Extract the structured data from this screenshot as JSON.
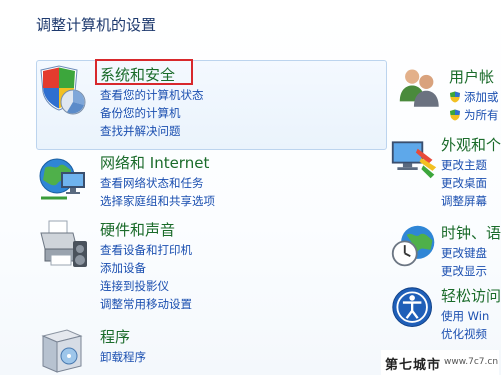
{
  "page_title": "调整计算机的设置",
  "left_categories": [
    {
      "title": "系统和安全",
      "icon": "shield-chart-icon",
      "links": [
        "查看您的计算机状态",
        "备份您的计算机",
        "查找并解决问题"
      ]
    },
    {
      "title": "网络和 Internet",
      "icon": "network-globe-icon",
      "links": [
        "查看网络状态和任务",
        "选择家庭组和共享选项"
      ]
    },
    {
      "title": "硬件和声音",
      "icon": "printer-icon",
      "links": [
        "查看设备和打印机",
        "添加设备",
        "连接到投影仪",
        "调整常用移动设置"
      ]
    },
    {
      "title": "程序",
      "icon": "program-box-icon",
      "links": [
        "卸载程序"
      ]
    }
  ],
  "right_categories": [
    {
      "title": "用户帐",
      "icon": "users-icon",
      "links": [
        "添加或",
        "为所有"
      ]
    },
    {
      "title": "外观和个",
      "icon": "appearance-icon",
      "links": [
        "更改主题",
        "更改桌面",
        "调整屏幕"
      ]
    },
    {
      "title": "时钟、语",
      "icon": "clock-globe-icon",
      "links": [
        "更改键盘",
        "更改显示"
      ]
    },
    {
      "title": "轻松访问",
      "icon": "ease-of-access-icon",
      "links": [
        "使用 Win",
        "优化视频"
      ]
    }
  ],
  "watermark": {
    "text": "第七城市",
    "url": "www.7c7.cn"
  },
  "colors": {
    "category_title": "#1a6b2a",
    "link": "#1b4fb0",
    "highlight_border": "#d8282c"
  }
}
